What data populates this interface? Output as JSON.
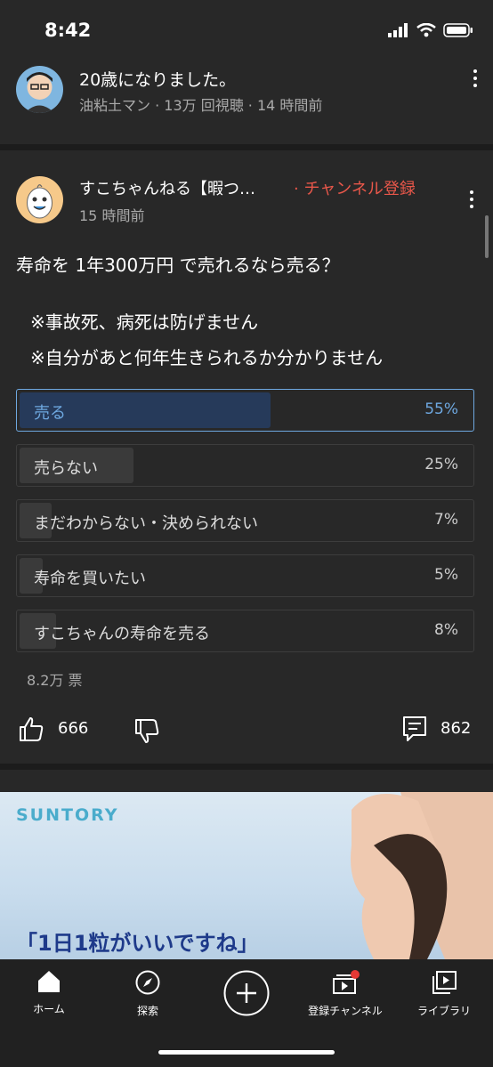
{
  "status": {
    "time": "8:42"
  },
  "prev_video": {
    "title": "20歳になりました。",
    "meta": "油粘土マン · 13万 回視聴 · 14 時間前"
  },
  "post": {
    "channel": "すこちゃんねる【暇つ…",
    "subscribe": "· チャンネル登録",
    "time": "15 時間前",
    "text_line1": "寿命を  1年300万円  で売れるなら売る？",
    "note1": "※事故死、病死は防げません",
    "note2": "※自分があと何年生きられるか分かりません",
    "poll": {
      "options": [
        {
          "label": "売る",
          "percent": "55%",
          "fill": 0.55,
          "selected": true
        },
        {
          "label": "売らない",
          "percent": "25%",
          "fill": 0.25,
          "selected": false
        },
        {
          "label": "まだわからない・決められない",
          "percent": "7%",
          "fill": 0.07,
          "selected": false
        },
        {
          "label": "寿命を買いたい",
          "percent": "5%",
          "fill": 0.05,
          "selected": false
        },
        {
          "label": "すこちゃんの寿命を売る",
          "percent": "8%",
          "fill": 0.08,
          "selected": false
        }
      ],
      "votes": "8.2万 票"
    },
    "likes": "666",
    "comments": "862"
  },
  "ad": {
    "brand": "SUNTORY",
    "copy": "「1日1粒がいいですね」"
  },
  "nav": {
    "home": "ホーム",
    "explore": "探索",
    "subscriptions": "登録チャンネル",
    "library": "ライブラリ"
  },
  "colors": {
    "accent_red": "#e8574a",
    "poll_blue": "#6ea8e0",
    "bg": "#282828"
  }
}
